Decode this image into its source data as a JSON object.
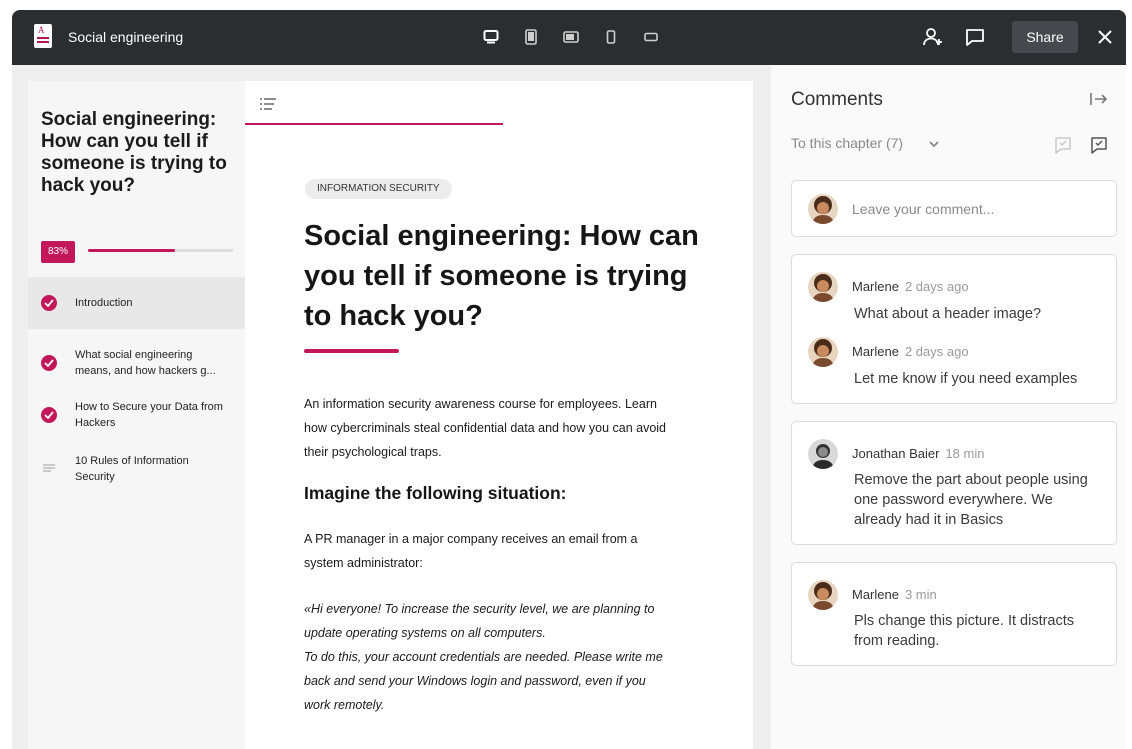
{
  "colors": {
    "accent": "#c2185b",
    "topbar": "#2b2d31"
  },
  "topbar": {
    "app_title": "Social engineering",
    "app_icon_letter": "A",
    "device_icons": [
      "desktop-icon",
      "tablet-portrait-icon",
      "tablet-landscape-icon",
      "phone-portrait-icon",
      "phone-landscape-icon"
    ],
    "share_label": "Share"
  },
  "sidebar": {
    "course_title": "Social engineering: How can you tell if someone is trying to hack you?",
    "progress_label": "83%",
    "progress_value": 0.6,
    "items": [
      {
        "label": "Introduction",
        "done": true,
        "active": true
      },
      {
        "label": "What social engineering means, and how hackers g...",
        "done": true,
        "active": false
      },
      {
        "label": "How to Secure your Data from Hackers",
        "done": true,
        "active": false
      },
      {
        "label": "10 Rules of Information Security",
        "done": false,
        "active": false
      }
    ]
  },
  "doc": {
    "tag": "INFORMATION SECURITY",
    "title": "Social engineering: How can you tell if someone is trying to hack you?",
    "intro": "An information security awareness course for employees. Learn how cybercriminals steal confidential data and how you can avoid their psychological traps.",
    "subheading": "Imagine the following situation:",
    "paragraph": "A PR manager in a major company receives an email from a system administrator:",
    "quote_1": "«Hi everyone! To increase the security level, we are planning to update operating systems on all computers.",
    "quote_2": "To do this, your account credentials are needed. Please write me back and send your Windows login and password, even if you work remotely."
  },
  "comments": {
    "title": "Comments",
    "filter_label": "To this chapter (7)",
    "input_placeholder": "Leave your comment...",
    "threads": [
      {
        "items": [
          {
            "author": "Marlene",
            "time": "2 days ago",
            "text": "What about a header image?"
          },
          {
            "author": "Marlene",
            "time": "2 days ago",
            "text": "Let me know if you need examples"
          }
        ]
      },
      {
        "items": [
          {
            "author": "Jonathan Baier",
            "time": "18 min",
            "text": "Remove the part about people using one password everywhere. We already had it in Basics"
          }
        ]
      },
      {
        "items": [
          {
            "author": "Marlene",
            "time": "3 min",
            "text": "Pls change this picture. It distracts from reading."
          }
        ]
      }
    ]
  }
}
